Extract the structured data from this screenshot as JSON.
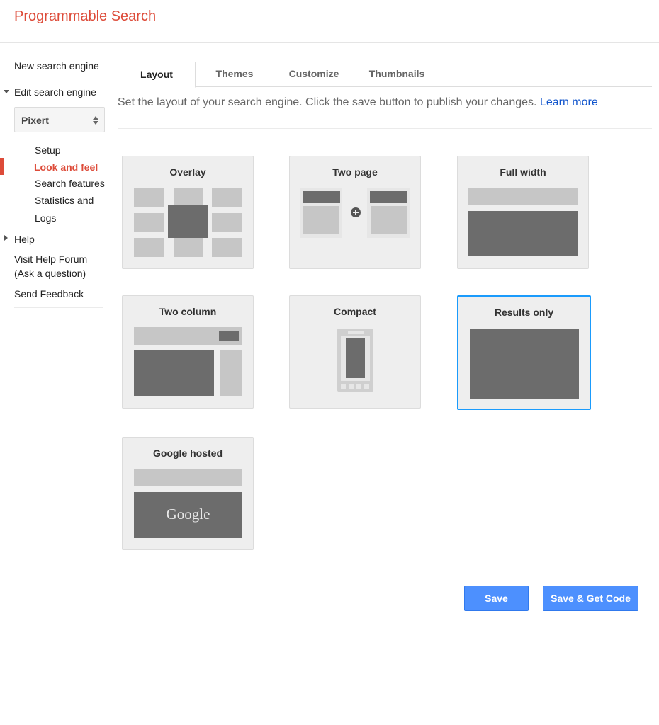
{
  "header": {
    "title": "Programmable Search"
  },
  "sidebar": {
    "new_engine": "New search engine",
    "edit_engine": "Edit search engine",
    "engine_select": {
      "value": "Pixert"
    },
    "sub_items": [
      {
        "label": "Setup"
      },
      {
        "label": "Look and feel",
        "active": true
      },
      {
        "label": "Search features"
      },
      {
        "label": "Statistics and"
      },
      {
        "label": "Logs"
      }
    ],
    "help": "Help",
    "help_forum_line1": "Visit Help Forum",
    "help_forum_line2": "(Ask a question)",
    "feedback": "Send Feedback"
  },
  "tabs": [
    {
      "label": "Layout",
      "active": true
    },
    {
      "label": "Themes"
    },
    {
      "label": "Customize"
    },
    {
      "label": "Thumbnails"
    }
  ],
  "description": {
    "text": "Set the layout of your search engine. Click the save button to publish your changes.",
    "link": "Learn more"
  },
  "layouts": [
    {
      "title": "Overlay"
    },
    {
      "title": "Two page"
    },
    {
      "title": "Full width"
    },
    {
      "title": "Two column"
    },
    {
      "title": "Compact"
    },
    {
      "title": "Results only",
      "selected": true
    },
    {
      "title": "Google hosted",
      "logo_text": "Google"
    }
  ],
  "buttons": {
    "save": "Save",
    "save_get_code": "Save & Get Code"
  },
  "colors": {
    "brand": "#dd4b39",
    "link": "#1155cc",
    "button": "#4d90fe",
    "selected_border": "#1a9bfc"
  }
}
